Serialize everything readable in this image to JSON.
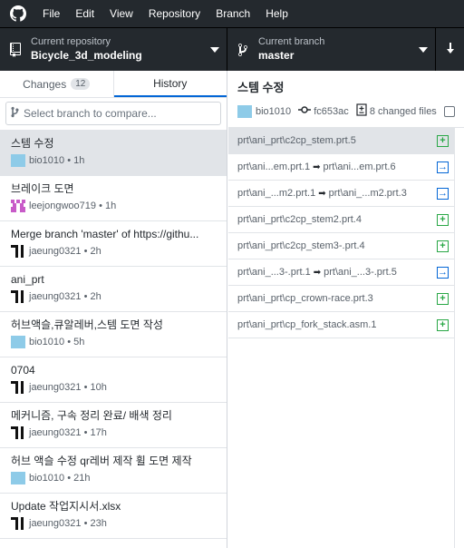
{
  "menubar": {
    "items": [
      "File",
      "Edit",
      "View",
      "Repository",
      "Branch",
      "Help"
    ]
  },
  "toolbar": {
    "repo_caption": "Current repository",
    "repo_name": "Bicycle_3d_modeling",
    "branch_caption": "Current branch",
    "branch_name": "master"
  },
  "tabs": {
    "changes_label": "Changes",
    "changes_count": "12",
    "history_label": "History"
  },
  "compare": {
    "placeholder": "Select branch to compare..."
  },
  "commits": [
    {
      "summary": "스템 수정",
      "author": "bio1010",
      "time": "1h",
      "avatar": "blue"
    },
    {
      "summary": "브레이크 도면",
      "author": "leejongwoo719",
      "time": "1h",
      "avatar": "pink"
    },
    {
      "summary": "Merge branch 'master' of https://githu...",
      "author": "jaeung0321",
      "time": "2h",
      "avatar": "black"
    },
    {
      "summary": "ani_prt",
      "author": "jaeung0321",
      "time": "2h",
      "avatar": "black"
    },
    {
      "summary": "허브액슬,큐알레버,스템 도면 작성",
      "author": "bio1010",
      "time": "5h",
      "avatar": "blue"
    },
    {
      "summary": "0704",
      "author": "jaeung0321",
      "time": "10h",
      "avatar": "black"
    },
    {
      "summary": "메커니즘, 구속 정리 완료/ 배색 정리",
      "author": "jaeung0321",
      "time": "17h",
      "avatar": "black"
    },
    {
      "summary": "허브 액슬 수정 qr레버 제작 휠 도면 제작",
      "author": "bio1010",
      "time": "21h",
      "avatar": "blue"
    },
    {
      "summary": "Update 작업지시서.xlsx",
      "author": "jaeung0321",
      "time": "23h",
      "avatar": "black"
    }
  ],
  "selected_commit": {
    "title": "스템 수정",
    "author": "bio1010",
    "sha": "fc653ac",
    "changed_files": "8 changed files"
  },
  "files": [
    {
      "path": "prt\\ani_prt\\c2cp_stem.prt.5",
      "status": "added"
    },
    {
      "from": "prt\\ani...em.prt.1",
      "to": "prt\\ani...em.prt.6",
      "status": "renamed"
    },
    {
      "from": "prt\\ani_...m2.prt.1",
      "to": "prt\\ani_...m2.prt.3",
      "status": "renamed"
    },
    {
      "path": "prt\\ani_prt\\c2cp_stem2.prt.4",
      "status": "added"
    },
    {
      "path": "prt\\ani_prt\\c2cp_stem3-.prt.4",
      "status": "added"
    },
    {
      "from": "prt\\ani_...3-.prt.1",
      "to": "prt\\ani_...3-.prt.5",
      "status": "renamed"
    },
    {
      "path": "prt\\ani_prt\\cp_crown-race.prt.3",
      "status": "added"
    },
    {
      "path": "prt\\ani_prt\\cp_fork_stack.asm.1",
      "status": "added"
    }
  ],
  "colors": {
    "accent": "#0366d6",
    "added": "#28a745",
    "toolbar_bg": "#24292e"
  }
}
